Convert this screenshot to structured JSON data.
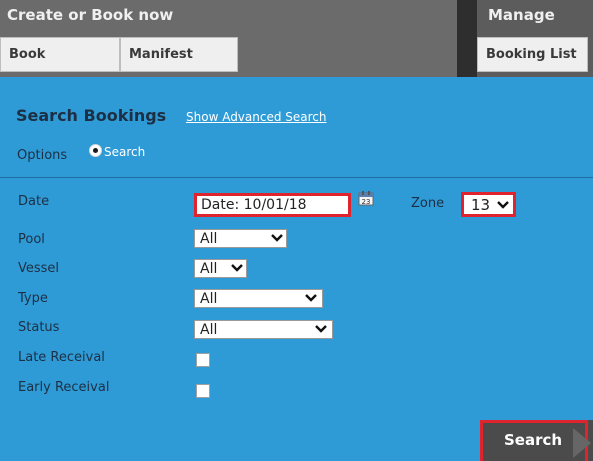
{
  "nav": {
    "create_heading": "Create or Book now",
    "manage_heading": "Manage",
    "tabs": [
      {
        "label": "Book"
      },
      {
        "label": "Manifest"
      },
      {
        "label": "Booking List"
      }
    ]
  },
  "search": {
    "title": "Search Bookings",
    "advanced_link": "Show Advanced Search",
    "options_label": "Options",
    "radio_label": "Search",
    "search_button": "Search"
  },
  "fields": {
    "date_label": "Date",
    "date_value": "Date: 10/01/18",
    "zone_label": "Zone",
    "zone_value": "13",
    "pool_label": "Pool",
    "pool_value": "All",
    "vessel_label": "Vessel",
    "vessel_value": "All",
    "type_label": "Type",
    "type_value": "All",
    "status_label": "Status",
    "status_value": "All",
    "late_receival_label": "Late Receival",
    "late_receival_checked": false,
    "early_receival_label": "Early Receival",
    "early_receival_checked": false
  },
  "icons": {
    "calendar": "calendar-icon",
    "chevron": "chevron-down-icon",
    "arrow": "arrow-right-icon"
  },
  "colors": {
    "panel_background": "#2e9bd6",
    "nav_background": "#6b6b6b",
    "highlight_outline": "#e0242e",
    "heading_text": "#1d2f44",
    "button_background": "#4b4b4b"
  }
}
